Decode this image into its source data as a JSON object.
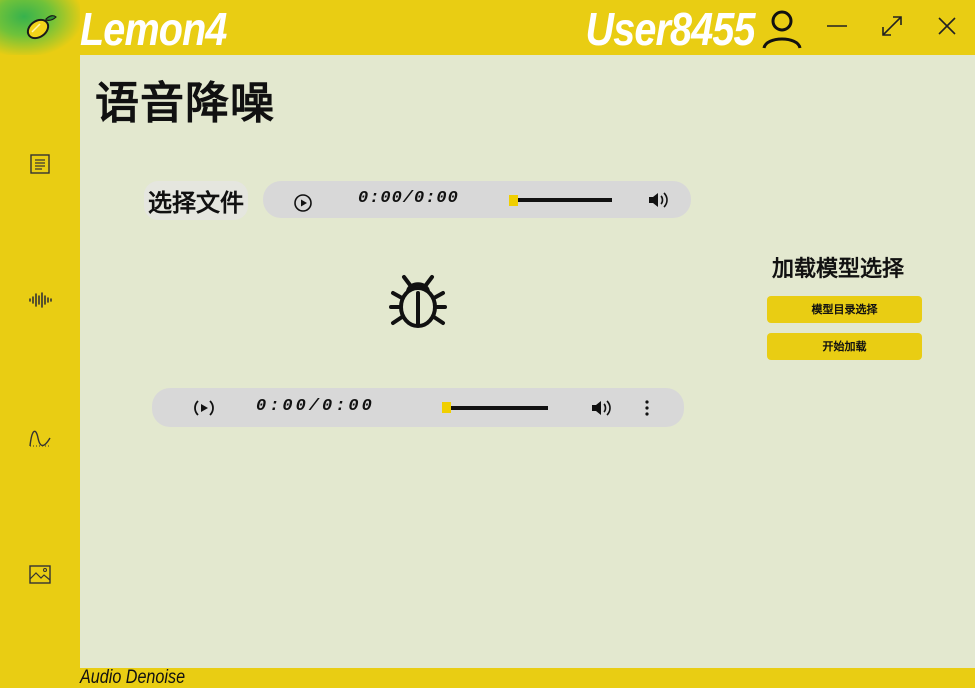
{
  "app": {
    "title": "Lemon4",
    "user": "User8455"
  },
  "window_controls": [
    "minimize",
    "maximize",
    "close"
  ],
  "sidebar": {
    "items": [
      {
        "icon": "document-icon"
      },
      {
        "icon": "waveform-icon"
      },
      {
        "icon": "curve-icon"
      },
      {
        "icon": "image-icon"
      }
    ]
  },
  "main": {
    "page_title": "语音降噪",
    "select_file_label": "选择文件",
    "input_player": {
      "time": "0:00/0:00",
      "progress": 0.0
    },
    "output_player": {
      "time": "0:00/0:00",
      "progress": 0.0
    },
    "model": {
      "heading": "加载模型选择",
      "dir_button": "模型目录选择",
      "load_button": "开始加载"
    }
  },
  "status": {
    "text": "Audio Denoise"
  },
  "colors": {
    "accent": "#E9CD13",
    "content_bg": "#E3E8CF",
    "player_bg": "#D8D8D8",
    "knob": "#F0CF00"
  }
}
